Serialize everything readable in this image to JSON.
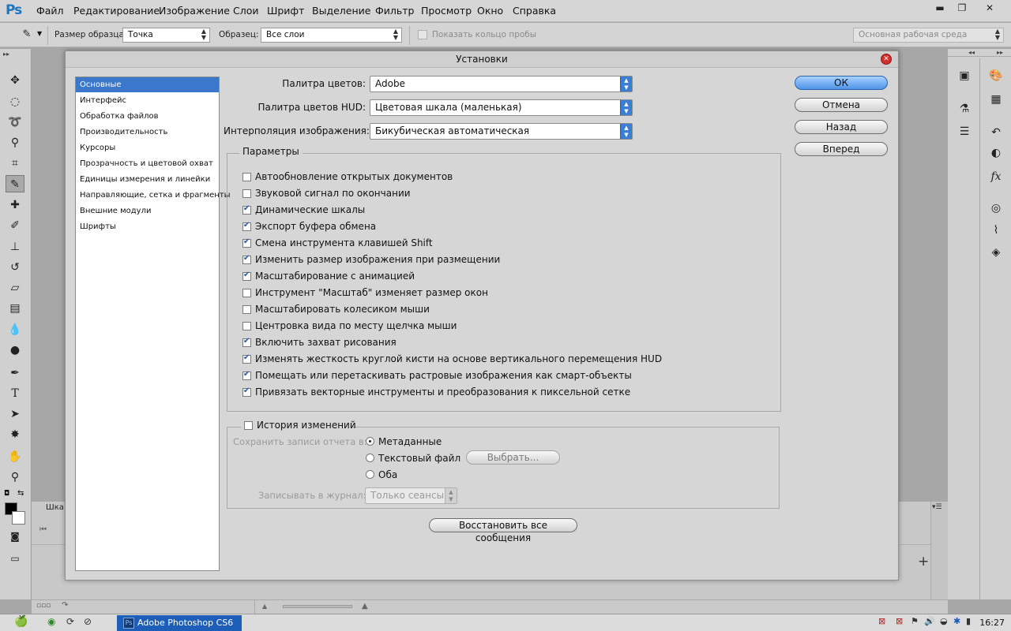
{
  "app": {
    "logo": "Ps",
    "menu": [
      "Файл",
      "Редактирование",
      "Изображение",
      "Слои",
      "Шрифт",
      "Выделение",
      "Фильтр",
      "Просмотр",
      "Окно",
      "Справка"
    ]
  },
  "window_controls": {
    "minimize": "▬",
    "restore": "❐",
    "close": "✕"
  },
  "options_bar": {
    "sample_size_label": "Размер образца:",
    "sample_size_value": "Точка",
    "sample_label": "Образец:",
    "sample_value": "Все слои",
    "show_ring_label": "Показать кольцо пробы",
    "workspace": "Основная рабочая среда"
  },
  "dialog": {
    "title": "Установки",
    "categories": [
      "Основные",
      "Интерфейс",
      "Обработка файлов",
      "Производительность",
      "Курсоры",
      "Прозрачность и цветовой охват",
      "Единицы измерения и линейки",
      "Направляющие, сетка и фрагменты",
      "Внешние модули",
      "Шрифты"
    ],
    "selected_category": "Основные",
    "color_picker_label": "Палитра цветов:",
    "color_picker_value": "Adobe",
    "hud_picker_label": "Палитра цветов HUD:",
    "hud_picker_value": "Цветовая шкала (маленькая)",
    "interp_label": "Интерполяция изображения:",
    "interp_value": "Бикубическая автоматическая",
    "options_title": "Параметры",
    "options": [
      {
        "label": "Автообновление открытых документов",
        "checked": false
      },
      {
        "label": "Звуковой сигнал по окончании",
        "checked": false
      },
      {
        "label": "Динамические шкалы",
        "checked": true
      },
      {
        "label": "Экспорт буфера обмена",
        "checked": true
      },
      {
        "label": "Смена инструмента клавишей Shift",
        "checked": true
      },
      {
        "label": "Изменить размер изображения при размещении",
        "checked": true
      },
      {
        "label": "Масштабирование с анимацией",
        "checked": true
      },
      {
        "label": "Инструмент \"Масштаб\" изменяет размер окон",
        "checked": false
      },
      {
        "label": "Масштабировать колесиком мыши",
        "checked": false
      },
      {
        "label": "Центровка вида по месту щелчка мыши",
        "checked": false
      },
      {
        "label": "Включить захват рисования",
        "checked": true
      },
      {
        "label": "Изменять жесткость круглой кисти на основе вертикального перемещения HUD",
        "checked": true
      },
      {
        "label": "Помещать или перетаскивать растровые изображения как смарт-объекты",
        "checked": true
      },
      {
        "label": "Привязать векторные инструменты и преобразования к пиксельной сетке",
        "checked": true
      }
    ],
    "history": {
      "title": "История изменений",
      "checked": false,
      "save_to_label": "Сохранить записи отчета в:",
      "radio_metadata": "Метаданные",
      "radio_textfile": "Текстовый файл",
      "radio_both": "Оба",
      "selected": "Метаданные",
      "choose_button": "Выбрать...",
      "log_label": "Записывать в журнал:",
      "log_value": "Только сеансы"
    },
    "reset_button": "Восстановить все сообщения",
    "buttons": {
      "ok": "ОК",
      "cancel": "Отмена",
      "back": "Назад",
      "forward": "Вперед"
    }
  },
  "bottom_panel": {
    "tab_label": "Шка",
    "add_icon": "+"
  },
  "taskbar": {
    "task_label": "Adobe Photoshop CS6",
    "clock": "16:27"
  }
}
